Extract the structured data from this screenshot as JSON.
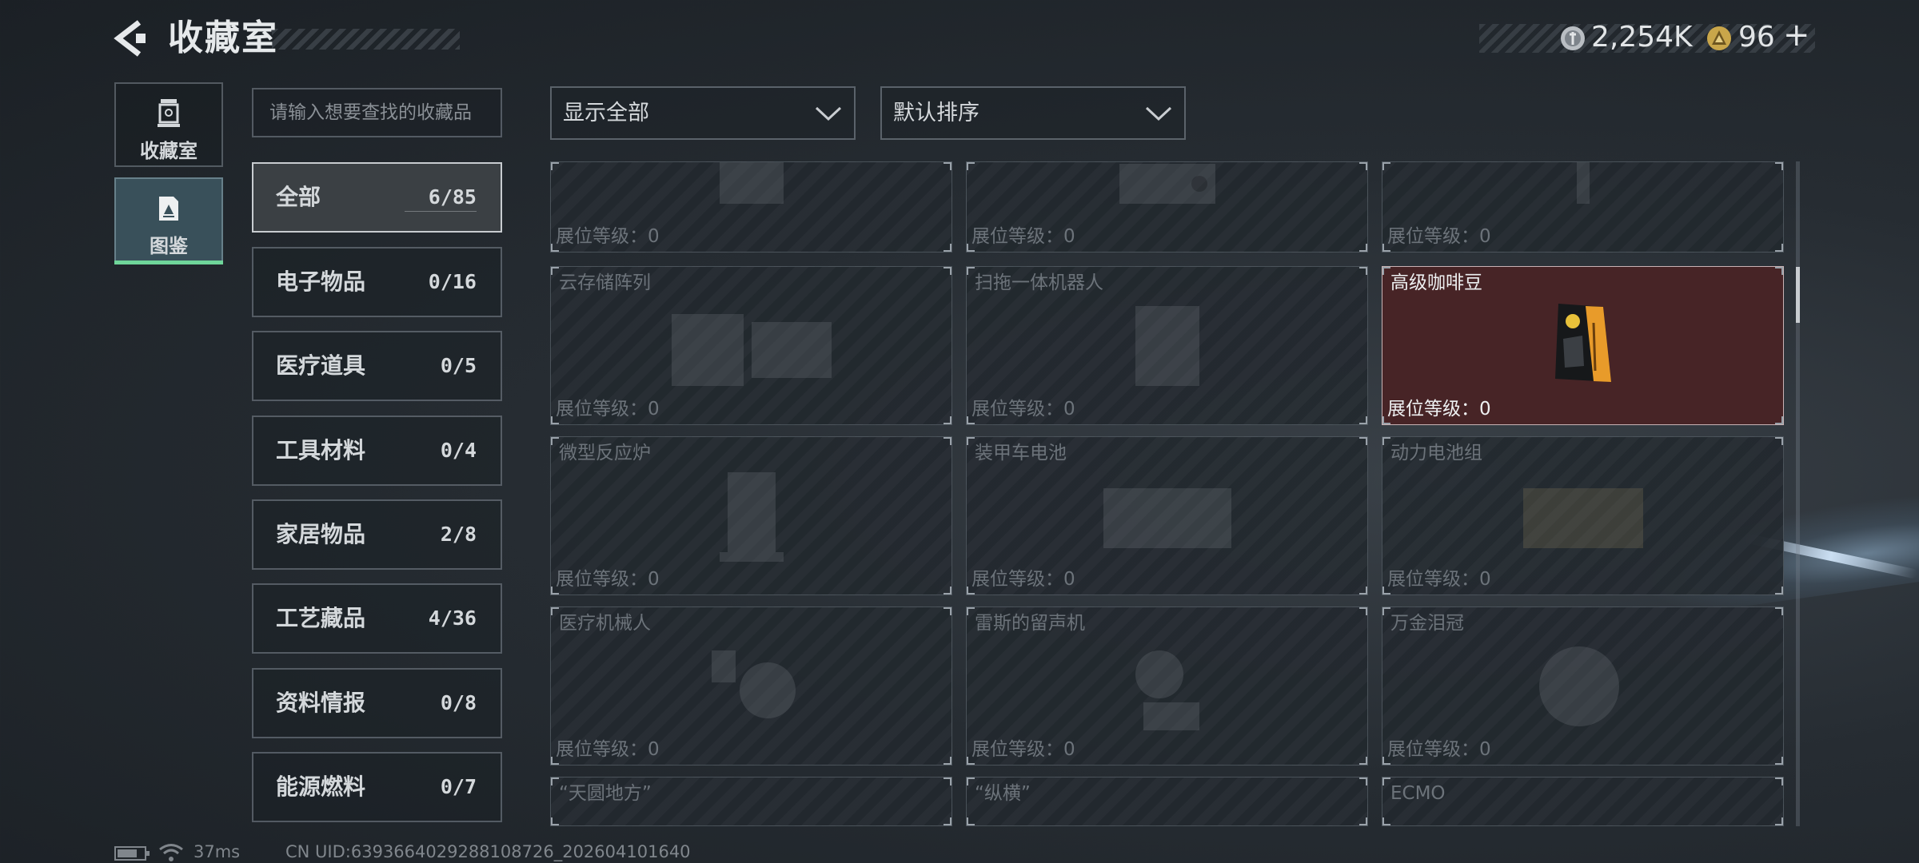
{
  "header": {
    "title": "收藏室",
    "currency_amount": "2,254K",
    "premium_amount": "96",
    "premium_plus": "+"
  },
  "nav": {
    "items": [
      {
        "label": "收藏室",
        "icon": "collection-room-icon"
      },
      {
        "label": "图鉴",
        "icon": "catalog-icon",
        "active": true
      }
    ]
  },
  "search": {
    "placeholder": "请输入想要查找的收藏品"
  },
  "categories": [
    {
      "name": "全部",
      "count": "6/85",
      "active": true
    },
    {
      "name": "电子物品",
      "count": "0/16"
    },
    {
      "name": "医疗道具",
      "count": "0/5"
    },
    {
      "name": "工具材料",
      "count": "0/4"
    },
    {
      "name": "家居物品",
      "count": "2/8"
    },
    {
      "name": "工艺藏品",
      "count": "4/36"
    },
    {
      "name": "资料情报",
      "count": "0/8"
    },
    {
      "name": "能源燃料",
      "count": "0/7"
    }
  ],
  "filters": {
    "display": "显示全部",
    "sort": "默认排序"
  },
  "items": [
    {
      "name": "",
      "level": "展位等级：0",
      "art": "box-art"
    },
    {
      "name": "",
      "level": "展位等级：0",
      "art": "device-art"
    },
    {
      "name": "",
      "level": "展位等级：0",
      "art": "bottle-art"
    },
    {
      "name": "云存储阵列",
      "level": "展位等级：0",
      "art": "server-art"
    },
    {
      "name": "扫拖一体机器人",
      "level": "展位等级：0",
      "art": "robot-art"
    },
    {
      "name": "高级咖啡豆",
      "level": "展位等级：0",
      "art": "coffee-bag-art",
      "unlocked": true
    },
    {
      "name": "微型反应炉",
      "level": "展位等级：0",
      "art": "reactor-art"
    },
    {
      "name": "装甲车电池",
      "level": "展位等级：0",
      "art": "battery-art"
    },
    {
      "name": "动力电池组",
      "level": "展位等级：0",
      "art": "battery-pack-art"
    },
    {
      "name": "医疗机械人",
      "level": "展位等级：0",
      "art": "med-robot-art"
    },
    {
      "name": "雷斯的留声机",
      "level": "展位等级：0",
      "art": "gramophone-art"
    },
    {
      "name": "万金泪冠",
      "level": "展位等级：0",
      "art": "crown-art"
    },
    {
      "name": "“天圆地方”",
      "level": "",
      "art": "coin-art"
    },
    {
      "name": "“纵横”",
      "level": "",
      "art": "figure-art"
    },
    {
      "name": "ECMO",
      "level": "",
      "art": "machine-art"
    }
  ],
  "status": {
    "ping": "37ms",
    "uid": "CN UID:6393664029288108726_202604101640"
  },
  "colors": {
    "accent_green": "#6fd59a",
    "unlocked_card": "#472426",
    "coffee_orange": "#e89b2a"
  }
}
